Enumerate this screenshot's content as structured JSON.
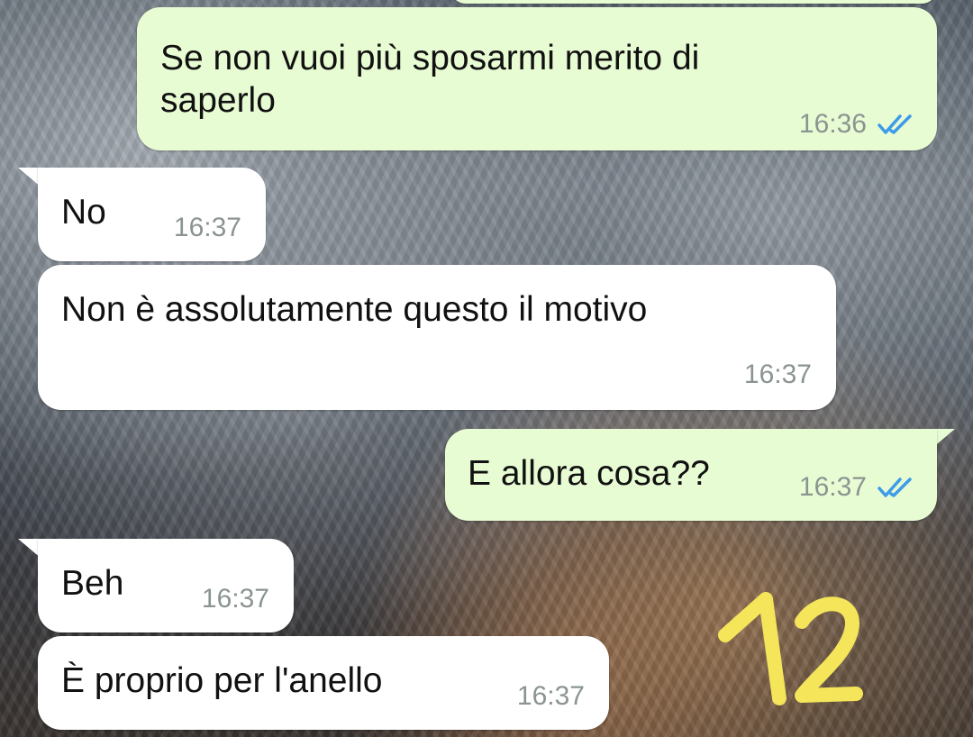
{
  "chat": {
    "messages": [
      {
        "direction": "out",
        "text": "Se non vuoi più sposarmi merito di\nsaperlo",
        "time": "16:36",
        "status": "read-ticks-icon"
      },
      {
        "direction": "in",
        "text": "No",
        "time": "16:37"
      },
      {
        "direction": "in",
        "text": "Non è assolutamente questo il motivo",
        "time": "16:37"
      },
      {
        "direction": "out",
        "text": "E allora cosa??",
        "time": "16:37",
        "status": "read-ticks-icon"
      },
      {
        "direction": "in",
        "text": "Beh",
        "time": "16:37"
      },
      {
        "direction": "in",
        "text": "È proprio per l'anello",
        "time": "16:37"
      }
    ]
  },
  "overlay": {
    "label": "12",
    "color": "#f4e55a"
  },
  "colors": {
    "outgoing_bubble": "#e8fcd4",
    "incoming_bubble": "#ffffff",
    "tick": "#3d9be9",
    "time": "#8a9490"
  }
}
